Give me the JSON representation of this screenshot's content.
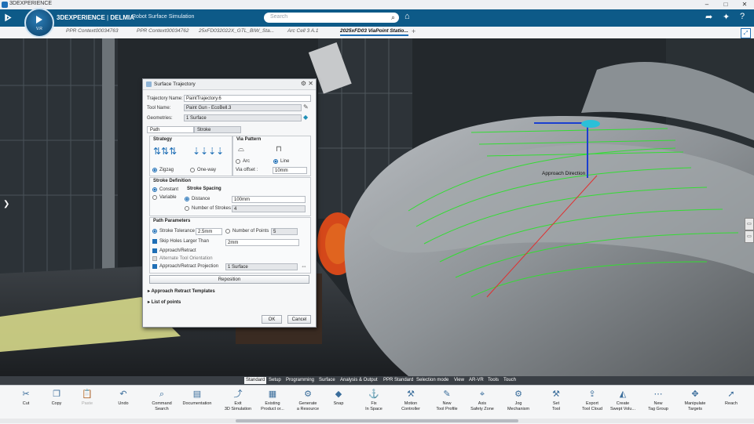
{
  "window": {
    "title": "3DEXPERIENCE",
    "controls": [
      "–",
      "□",
      "✕"
    ]
  },
  "topbar": {
    "brand_bold": "3DEXPERIENCE",
    "brand_sep": " | ",
    "brand_app": "DELMIA",
    "product": "Robot Surface Simulation",
    "compass_version": "V.R",
    "search_placeholder": "Search"
  },
  "context_tabs": [
    {
      "label": "PPR Context00034763",
      "active": false
    },
    {
      "label": "PPR Context00034762",
      "active": false
    },
    {
      "label": "25xFD032022X_GTL_BIW_Sta...",
      "active": false
    },
    {
      "label": "Arc Cell 3 A.1",
      "active": false
    },
    {
      "label": "2025xFD03 ViaPoint Statio...",
      "active": true
    }
  ],
  "viewport": {
    "approach_label": "Approach Direction"
  },
  "dialog": {
    "title": "Surface Trajectory",
    "trajectory_name_label": "Trajectory Name:",
    "trajectory_name_value": "PaintTrajectory.6",
    "tool_name_label": "Tool Name:",
    "tool_name_value": "Paint Gun - EcoBell.3",
    "geometries_label": "Geometries:",
    "geometries_value": "1 Surface",
    "tabs": [
      "Path",
      "Stroke"
    ],
    "strategy": {
      "title": "Strategy",
      "options": [
        "Zigzag",
        "One-way"
      ],
      "selected": "Zigzag"
    },
    "via_pattern": {
      "title": "Via Pattern",
      "options": [
        "Arc",
        "Line"
      ],
      "selected": "Line",
      "offset_label": "Via offset :",
      "offset_value": "10mm"
    },
    "stroke_definition": {
      "title": "Stroke Definition",
      "modes": [
        "Constant",
        "Variable"
      ],
      "selected": "Constant",
      "spacing_title": "Stroke Spacing",
      "distance_label": "Distance",
      "distance_value": "100mm",
      "num_strokes_label": "Number of Strokes",
      "num_strokes_value": "4"
    },
    "path_parameters": {
      "title": "Path Parameters",
      "stroke_tolerance_label": "Stroke Tolerance",
      "stroke_tolerance_value": "2.5mm",
      "number_of_points_label": "Number of Points",
      "number_of_points_value": "5",
      "skip_holes_label": "Skip Holes Larger Than",
      "skip_holes_value": "2mm",
      "approach_retract_label": "Approach/Retract",
      "alternate_orientation_label": "Alternate Tool Orientation",
      "ar_projection_label": "Approach/Retract Projection",
      "ar_projection_value": "1 Surface"
    },
    "reposition_label": "Reposition",
    "approach_templates_label": "Approach Retract Templates",
    "list_of_points_label": "List of points",
    "ok_label": "OK",
    "cancel_label": "Cancel"
  },
  "ribbon_tabs": [
    {
      "label": "Standard",
      "active": true
    },
    {
      "label": "Setup",
      "active": false
    },
    {
      "label": "Programming",
      "active": false
    },
    {
      "label": "Surface",
      "active": false
    },
    {
      "label": "Analysis & Output",
      "active": false
    },
    {
      "label": "PPR Standard",
      "active": false
    },
    {
      "label": "Selection mode",
      "active": false
    },
    {
      "label": "View",
      "active": false
    },
    {
      "label": "AR-VR",
      "active": false
    },
    {
      "label": "Tools",
      "active": false
    },
    {
      "label": "Touch",
      "active": false
    }
  ],
  "tools": [
    {
      "label": "Cut",
      "icon": "scissors-icon",
      "glyph": "✂",
      "enabled": true
    },
    {
      "label": "Copy",
      "icon": "copy-icon",
      "glyph": "❐",
      "enabled": true
    },
    {
      "label": "Paste",
      "icon": "paste-icon",
      "glyph": "📋",
      "enabled": false
    },
    {
      "label": "Undo",
      "icon": "undo-icon",
      "glyph": "↶",
      "enabled": true
    },
    {
      "label": "Command\nSearch",
      "icon": "command-search-icon",
      "glyph": "⌕",
      "enabled": true
    },
    {
      "label": "Documentation",
      "icon": "book-icon",
      "glyph": "▤",
      "enabled": true
    },
    {
      "label": "Exit\n3D Simulation",
      "icon": "exit-sim-icon",
      "glyph": "⤴",
      "enabled": true
    },
    {
      "label": "Existing\nProduct or...",
      "icon": "product-icon",
      "glyph": "▦",
      "enabled": true
    },
    {
      "label": "Generate\na Resource",
      "icon": "resource-icon",
      "glyph": "⚙",
      "enabled": true
    },
    {
      "label": "Snap",
      "icon": "snap-icon",
      "glyph": "◆",
      "enabled": true
    },
    {
      "label": "Fix\nIn Space",
      "icon": "fix-icon",
      "glyph": "⚓",
      "enabled": true
    },
    {
      "label": "Motion\nController",
      "icon": "motion-icon",
      "glyph": "⚒",
      "enabled": true
    },
    {
      "label": "New\nTool Profile",
      "icon": "tool-profile-icon",
      "glyph": "✎",
      "enabled": true
    },
    {
      "label": "Axis\nSafety Zone",
      "icon": "axis-zone-icon",
      "glyph": "⌖",
      "enabled": true
    },
    {
      "label": "Jog\nMechanism",
      "icon": "jog-icon",
      "glyph": "⚙",
      "enabled": true
    },
    {
      "label": "Set\nTool",
      "icon": "set-tool-icon",
      "glyph": "⚒",
      "enabled": true
    },
    {
      "label": "Export\nTool Cloud",
      "icon": "export-icon",
      "glyph": "⇪",
      "enabled": true
    },
    {
      "label": "Create\nSwept Volu...",
      "icon": "swept-icon",
      "glyph": "◭",
      "enabled": true
    },
    {
      "label": "New\nTag Group",
      "icon": "tag-group-icon",
      "glyph": "⋯",
      "enabled": true
    },
    {
      "label": "Manipulate\nTargets",
      "icon": "targets-icon",
      "glyph": "✥",
      "enabled": true
    },
    {
      "label": "Reach",
      "icon": "reach-icon",
      "glyph": "➚",
      "enabled": true
    }
  ]
}
